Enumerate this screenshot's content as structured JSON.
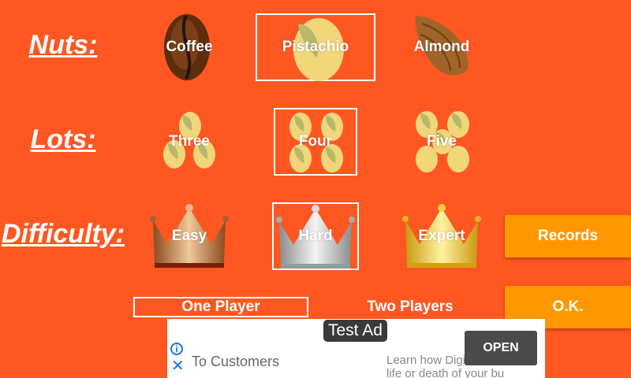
{
  "labels": {
    "nuts": "Nuts:",
    "lots": "Lots:",
    "difficulty": "Difficulty:"
  },
  "nuts": [
    {
      "label": "Coffee",
      "icon": "coffee-bean-icon",
      "selected": false
    },
    {
      "label": "Pistachio",
      "icon": "pistachio-icon",
      "selected": true
    },
    {
      "label": "Almond",
      "icon": "almond-icon",
      "selected": false
    }
  ],
  "lots": [
    {
      "label": "Three",
      "icon": "three-pistachios-icon",
      "selected": false
    },
    {
      "label": "Four",
      "icon": "four-pistachios-icon",
      "selected": true
    },
    {
      "label": "Five",
      "icon": "five-pistachios-icon",
      "selected": false
    }
  ],
  "difficulty": [
    {
      "label": "Easy",
      "icon": "bronze-crown-icon",
      "selected": false
    },
    {
      "label": "Hard",
      "icon": "silver-crown-icon",
      "selected": true
    },
    {
      "label": "Expert",
      "icon": "gold-crown-icon",
      "selected": false
    }
  ],
  "buttons": {
    "records": "Records",
    "ok": "O.K."
  },
  "players": {
    "one": "One Player",
    "two": "Two Players",
    "selected": "one"
  },
  "ad": {
    "badge": "Test Ad",
    "headline": "To Customers",
    "open": "OPEN",
    "subtext_line1": "Learn how Digital",
    "subtext_line2": "life or death of your bu"
  },
  "colors": {
    "background": "#ff5722",
    "button": "#ff9800"
  }
}
